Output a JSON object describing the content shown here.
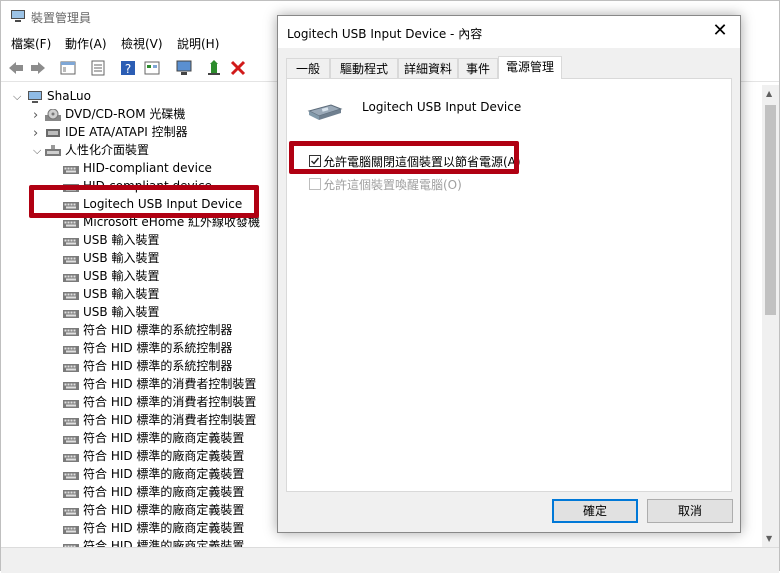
{
  "main_window": {
    "title": "裝置管理員",
    "menu": [
      "檔案(F)",
      "動作(A)",
      "檢視(V)",
      "說明(H)"
    ],
    "tree": [
      {
        "label": "ShaLuo",
        "level": 0,
        "expander": "v",
        "icon": "computer-icon"
      },
      {
        "label": "DVD/CD-ROM 光碟機",
        "level": 1,
        "expander": ">",
        "icon": "optical-drive-icon"
      },
      {
        "label": "IDE ATA/ATAPI 控制器",
        "level": 1,
        "expander": ">",
        "icon": "ide-controller-icon"
      },
      {
        "label": "人性化介面裝置",
        "level": 1,
        "expander": "v",
        "icon": "hid-icon"
      },
      {
        "label": "HID-compliant device",
        "level": 2,
        "icon": "hid-device-icon"
      },
      {
        "label": "HID-compliant device",
        "level": 2,
        "icon": "hid-device-icon"
      },
      {
        "label": "Logitech USB Input Device",
        "level": 2,
        "icon": "hid-device-icon"
      },
      {
        "label": "Microsoft eHome 紅外線收發機",
        "level": 2,
        "icon": "hid-device-icon"
      },
      {
        "label": "USB 輸入裝置",
        "level": 2,
        "icon": "hid-device-icon"
      },
      {
        "label": "USB 輸入裝置",
        "level": 2,
        "icon": "hid-device-icon"
      },
      {
        "label": "USB 輸入裝置",
        "level": 2,
        "icon": "hid-device-icon"
      },
      {
        "label": "USB 輸入裝置",
        "level": 2,
        "icon": "hid-device-icon"
      },
      {
        "label": "USB 輸入裝置",
        "level": 2,
        "icon": "hid-device-icon"
      },
      {
        "label": "符合 HID 標準的系統控制器",
        "level": 2,
        "icon": "hid-device-icon"
      },
      {
        "label": "符合 HID 標準的系統控制器",
        "level": 2,
        "icon": "hid-device-icon"
      },
      {
        "label": "符合 HID 標準的系統控制器",
        "level": 2,
        "icon": "hid-device-icon"
      },
      {
        "label": "符合 HID 標準的消費者控制裝置",
        "level": 2,
        "icon": "hid-device-icon"
      },
      {
        "label": "符合 HID 標準的消費者控制裝置",
        "level": 2,
        "icon": "hid-device-icon"
      },
      {
        "label": "符合 HID 標準的消費者控制裝置",
        "level": 2,
        "icon": "hid-device-icon"
      },
      {
        "label": "符合 HID 標準的廠商定義裝置",
        "level": 2,
        "icon": "hid-device-icon"
      },
      {
        "label": "符合 HID 標準的廠商定義裝置",
        "level": 2,
        "icon": "hid-device-icon"
      },
      {
        "label": "符合 HID 標準的廠商定義裝置",
        "level": 2,
        "icon": "hid-device-icon"
      },
      {
        "label": "符合 HID 標準的廠商定義裝置",
        "level": 2,
        "icon": "hid-device-icon"
      },
      {
        "label": "符合 HID 標準的廠商定義裝置",
        "level": 2,
        "icon": "hid-device-icon"
      },
      {
        "label": "符合 HID 標準的廠商定義裝置",
        "level": 2,
        "icon": "hid-device-icon"
      },
      {
        "label": "符合 HID 標準的廠商定義裝置",
        "level": 2,
        "icon": "hid-device-icon"
      }
    ]
  },
  "dialog": {
    "title": "Logitech USB Input Device - 內容",
    "tabs": [
      "一般",
      "驅動程式",
      "詳細資料",
      "事件",
      "電源管理"
    ],
    "active_tab": 4,
    "device_name": "Logitech USB Input Device",
    "options": [
      {
        "label": "允許電腦關閉這個裝置以節省電源(A)",
        "checked": true,
        "disabled": false
      },
      {
        "label": "允許這個裝置喚醒電腦(O)",
        "checked": false,
        "disabled": true
      }
    ],
    "ok_label": "確定",
    "cancel_label": "取消"
  },
  "colors": {
    "highlight": "#b00012",
    "focus": "#0078d7"
  }
}
